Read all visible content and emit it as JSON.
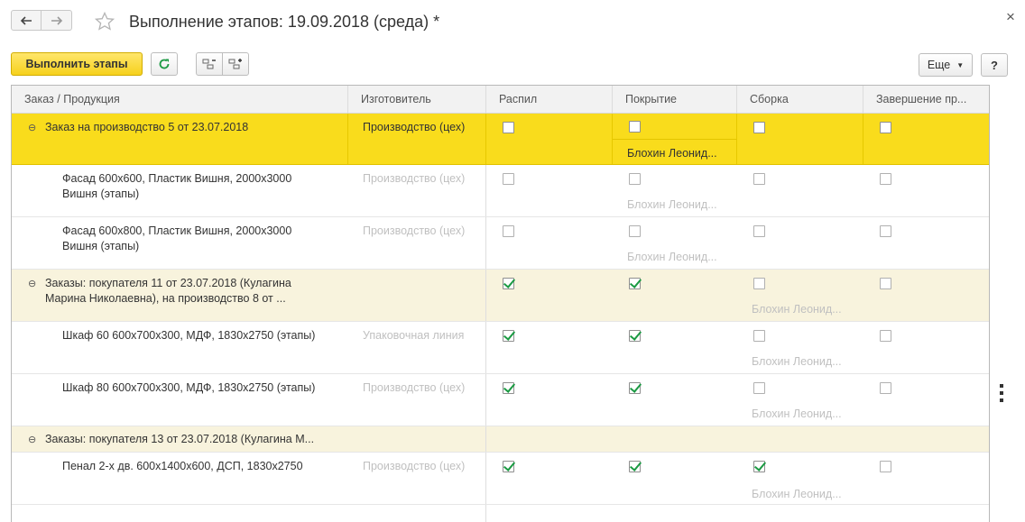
{
  "window": {
    "title": "Выполнение этапов: 19.09.2018 (среда) *",
    "close_symbol": "×"
  },
  "toolbar": {
    "run_label": "Выполнить этапы",
    "more_label": "Еще",
    "help_label": "?"
  },
  "icons": {
    "back": "arrow-left-icon",
    "forward": "arrow-right-icon",
    "favorite": "star-icon",
    "refresh": "refresh-icon",
    "collapse": "collapse-tree-icon",
    "expand": "expand-tree-icon"
  },
  "colors": {
    "selected_row": "#f9dc1c",
    "group_row": "#f8f3dd",
    "check": "#1b9a43",
    "run_button": "#f6d11c"
  },
  "table": {
    "columns": [
      "Заказ / Продукция",
      "Изготовитель",
      "Распил",
      "Покрытие",
      "Сборка",
      "Завершение пр..."
    ],
    "rows": [
      {
        "kind": "selected-group",
        "toggle": "⊖",
        "product": "Заказ на производство 5 от 23.07.2018",
        "maker": "Производство (цех)",
        "raspil": false,
        "pokrytie": false,
        "sborka": false,
        "zavershenie": false,
        "pokrytie_worker": "Блохин Леонид..."
      },
      {
        "kind": "item",
        "product": "Фасад 600х600, Пластик Вишня, 2000х3000 Вишня (этапы)",
        "maker": "Производство (цех)",
        "raspil": false,
        "pokrytie": false,
        "sborka": false,
        "zavershenie": false,
        "pokrytie_worker": "Блохин Леонид..."
      },
      {
        "kind": "item",
        "product": "Фасад 600х800, Пластик Вишня, 2000х3000 Вишня (этапы)",
        "maker": "Производство (цех)",
        "raspil": false,
        "pokrytie": false,
        "sborka": false,
        "zavershenie": false,
        "pokrytie_worker": "Блохин Леонид..."
      },
      {
        "kind": "group",
        "toggle": "⊖",
        "product": "Заказы: покупателя 11 от 23.07.2018  (Кулагина Марина Николаевна), на производство 8 от ...",
        "raspil": true,
        "pokrytie": true,
        "sborka": false,
        "zavershenie": false,
        "sborka_worker": "Блохин Леонид..."
      },
      {
        "kind": "item",
        "product": "Шкаф 60 600х700х300, МДФ, 1830х2750 (этапы)",
        "maker": "Упаковочная линия",
        "raspil": true,
        "pokrytie": true,
        "sborka": false,
        "zavershenie": false,
        "sborka_worker": "Блохин Леонид..."
      },
      {
        "kind": "item",
        "product": "Шкаф 80 600х700х300, МДФ, 1830х2750 (этапы)",
        "maker": "Производство (цех)",
        "raspil": true,
        "pokrytie": true,
        "sborka": false,
        "zavershenie": false,
        "sborka_worker": "Блохин Леонид..."
      },
      {
        "kind": "group",
        "toggle": "⊖",
        "product": "Заказы: покупателя 13 от 23.07.2018  (Кулагина М..."
      },
      {
        "kind": "item",
        "product": "Пенал 2-х дв. 600х1400х600, ДСП, 1830х2750",
        "maker": "Производство (цех)",
        "raspil": true,
        "pokrytie": true,
        "sborka": true,
        "zavershenie": false,
        "sborka_worker": "Блохин Леонид..."
      }
    ]
  }
}
